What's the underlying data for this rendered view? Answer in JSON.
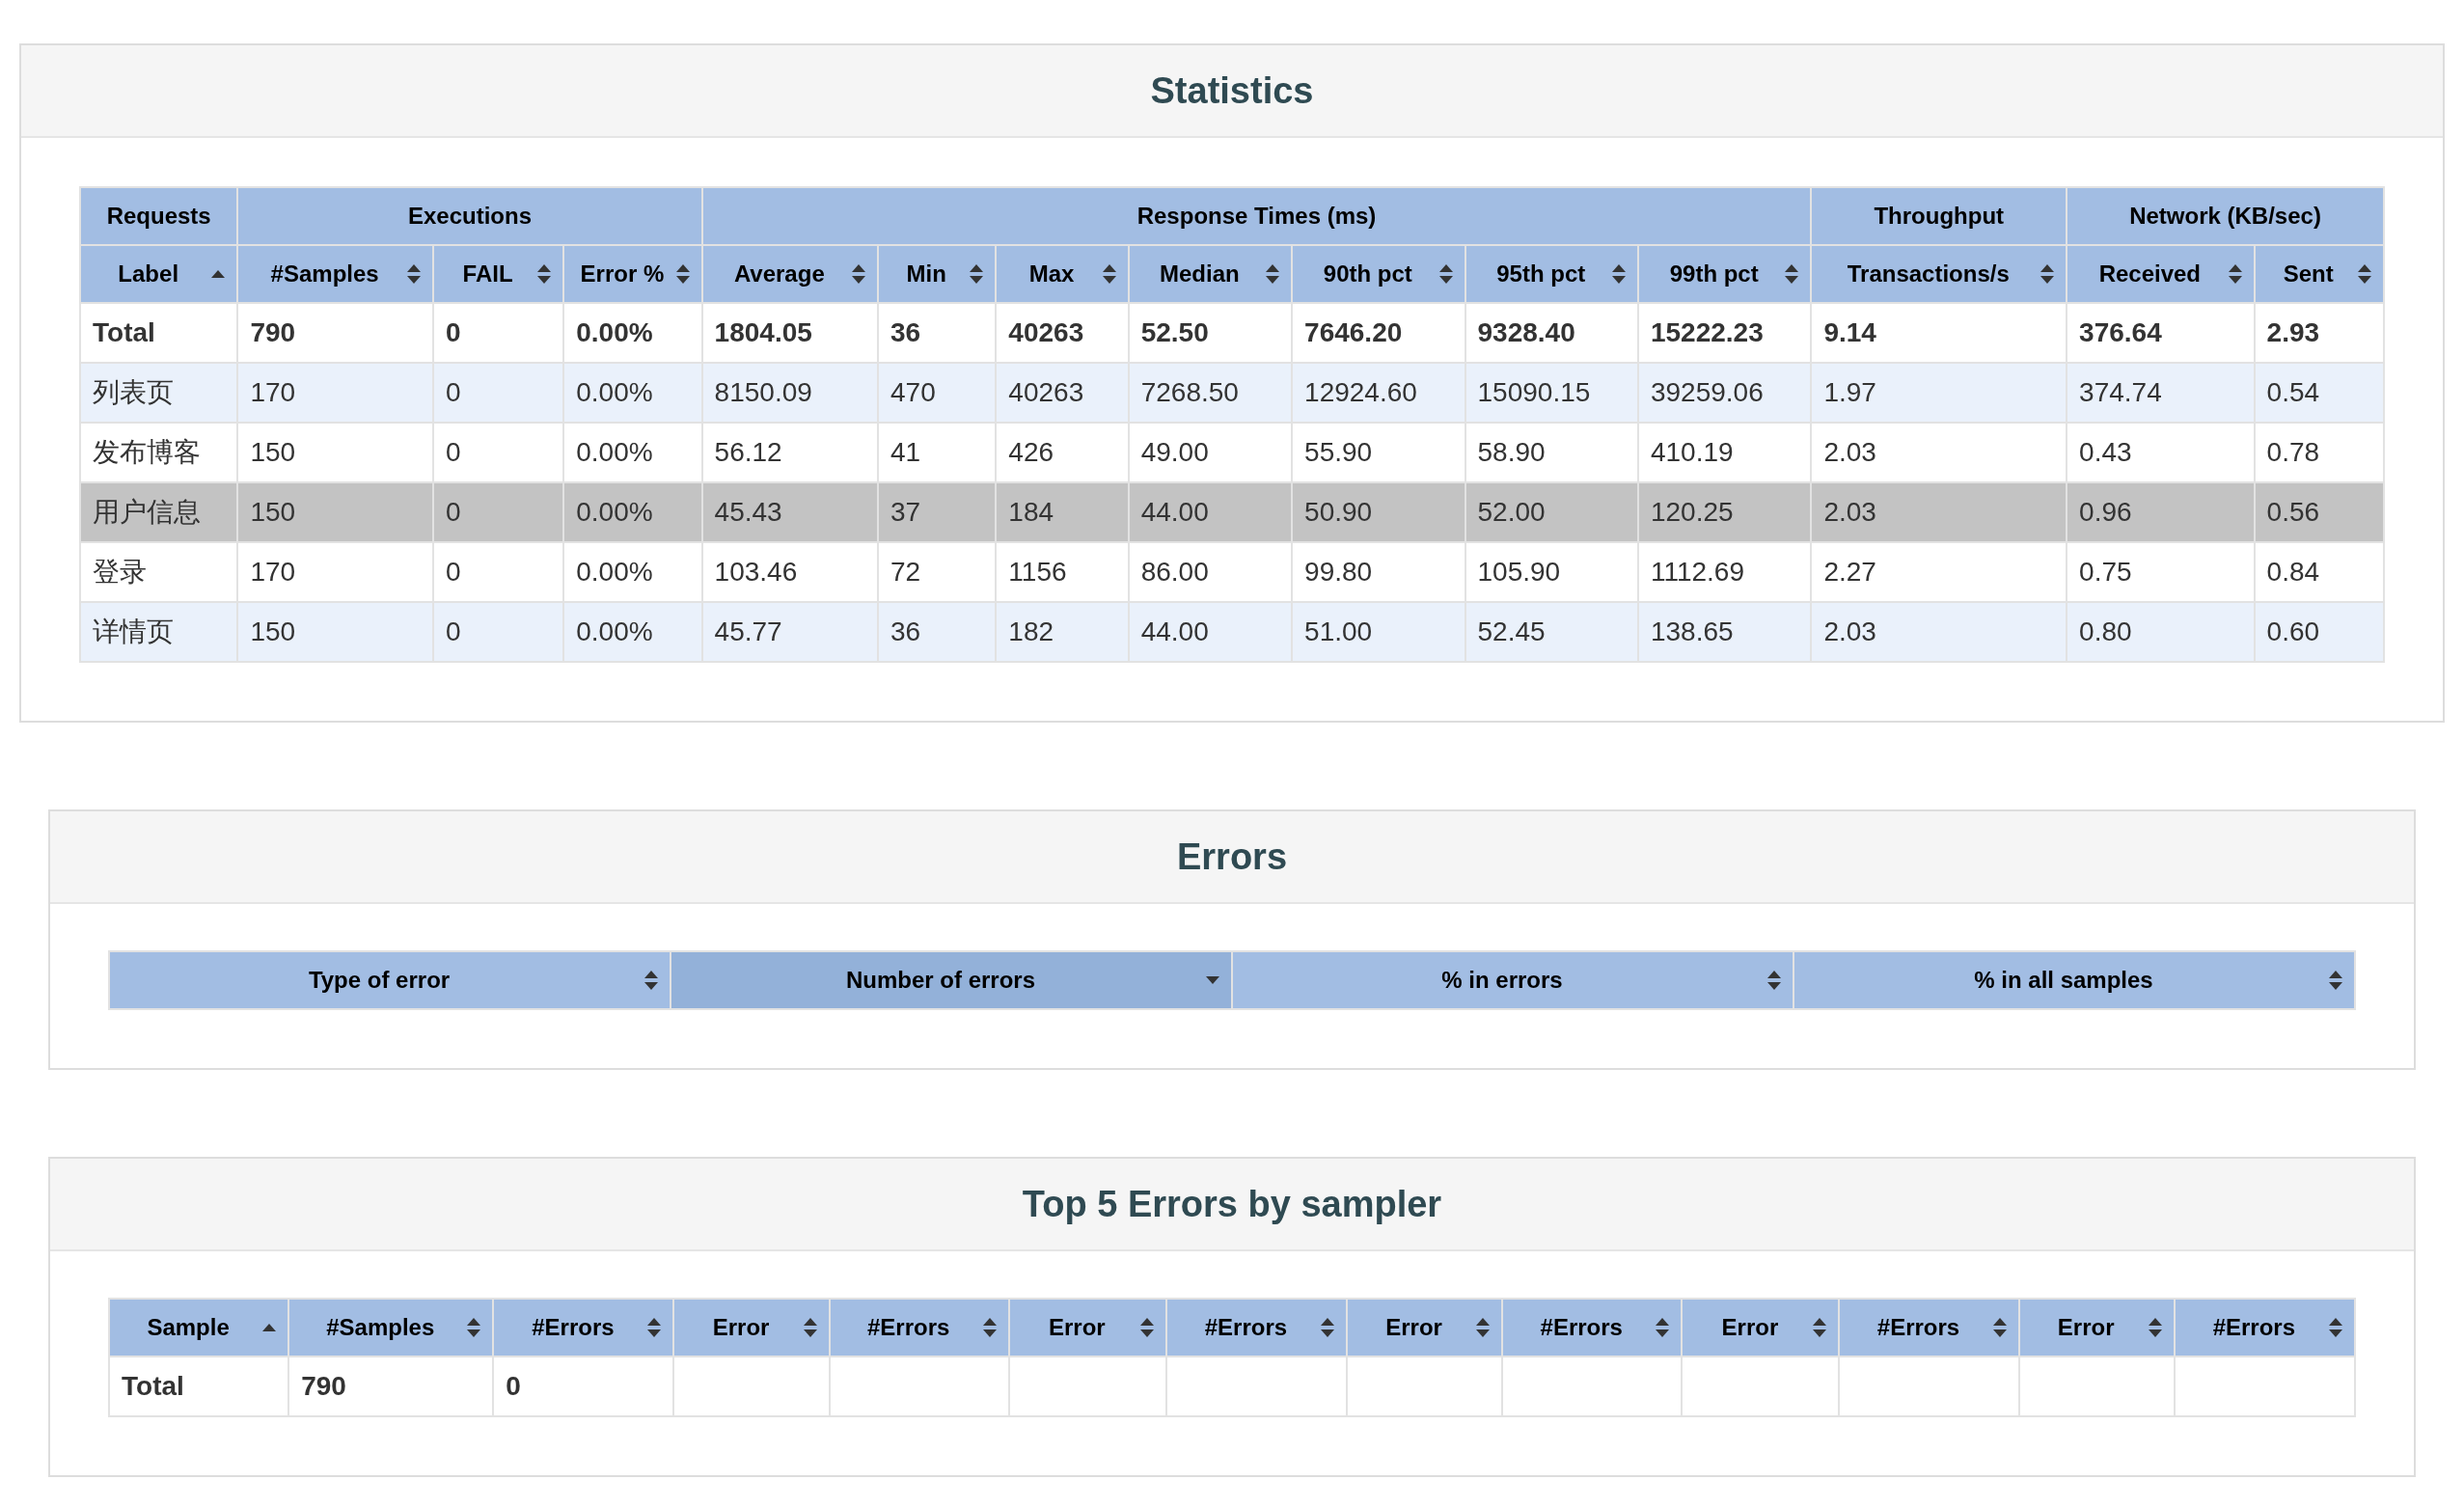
{
  "statistics": {
    "title": "Statistics",
    "groups": [
      {
        "label": "Requests",
        "columns": [
          {
            "label": "Label",
            "sort_asc": true,
            "sort_desc": false
          }
        ]
      },
      {
        "label": "Executions",
        "columns": [
          {
            "label": "#Samples",
            "sort_asc": false,
            "sort_desc": false
          },
          {
            "label": "FAIL",
            "sort_asc": false,
            "sort_desc": false
          },
          {
            "label": "Error %",
            "sort_asc": false,
            "sort_desc": false
          }
        ]
      },
      {
        "label": "Response Times (ms)",
        "columns": [
          {
            "label": "Average",
            "sort_asc": false,
            "sort_desc": false
          },
          {
            "label": "Min",
            "sort_asc": false,
            "sort_desc": false
          },
          {
            "label": "Max",
            "sort_asc": false,
            "sort_desc": false
          },
          {
            "label": "Median",
            "sort_asc": false,
            "sort_desc": false
          },
          {
            "label": "90th pct",
            "sort_asc": false,
            "sort_desc": false
          },
          {
            "label": "95th pct",
            "sort_asc": false,
            "sort_desc": false
          },
          {
            "label": "99th pct",
            "sort_asc": false,
            "sort_desc": false
          }
        ]
      },
      {
        "label": "Throughput",
        "columns": [
          {
            "label": "Transactions/s",
            "sort_asc": false,
            "sort_desc": false
          }
        ]
      },
      {
        "label": "Network (KB/sec)",
        "columns": [
          {
            "label": "Received",
            "sort_asc": false,
            "sort_desc": false
          },
          {
            "label": "Sent",
            "sort_asc": false,
            "sort_desc": false
          }
        ]
      }
    ],
    "rows": [
      {
        "kind": "total",
        "selected": false,
        "cells": [
          "Total",
          "790",
          "0",
          "0.00%",
          "1804.05",
          "36",
          "40263",
          "52.50",
          "7646.20",
          "9328.40",
          "15222.23",
          "9.14",
          "376.64",
          "2.93"
        ]
      },
      {
        "kind": "sample",
        "selected": false,
        "cells": [
          "列表页",
          "170",
          "0",
          "0.00%",
          "8150.09",
          "470",
          "40263",
          "7268.50",
          "12924.60",
          "15090.15",
          "39259.06",
          "1.97",
          "374.74",
          "0.54"
        ]
      },
      {
        "kind": "sample",
        "selected": false,
        "cells": [
          "发布博客",
          "150",
          "0",
          "0.00%",
          "56.12",
          "41",
          "426",
          "49.00",
          "55.90",
          "58.90",
          "410.19",
          "2.03",
          "0.43",
          "0.78"
        ]
      },
      {
        "kind": "sample",
        "selected": true,
        "cells": [
          "用户信息",
          "150",
          "0",
          "0.00%",
          "45.43",
          "37",
          "184",
          "44.00",
          "50.90",
          "52.00",
          "120.25",
          "2.03",
          "0.96",
          "0.56"
        ]
      },
      {
        "kind": "sample",
        "selected": false,
        "cells": [
          "登录",
          "170",
          "0",
          "0.00%",
          "103.46",
          "72",
          "1156",
          "86.00",
          "99.80",
          "105.90",
          "1112.69",
          "2.27",
          "0.75",
          "0.84"
        ]
      },
      {
        "kind": "sample",
        "selected": false,
        "cells": [
          "详情页",
          "150",
          "0",
          "0.00%",
          "45.77",
          "36",
          "182",
          "44.00",
          "51.00",
          "52.45",
          "138.65",
          "2.03",
          "0.80",
          "0.60"
        ]
      }
    ]
  },
  "errors": {
    "title": "Errors",
    "columns": [
      {
        "label": "Type of error",
        "sort_asc": false,
        "sort_desc": false
      },
      {
        "label": "Number of errors",
        "sort_asc": false,
        "sort_desc": true
      },
      {
        "label": "% in errors",
        "sort_asc": false,
        "sort_desc": false
      },
      {
        "label": "% in all samples",
        "sort_asc": false,
        "sort_desc": false
      }
    ]
  },
  "top5": {
    "title": "Top 5 Errors by sampler",
    "columns": [
      {
        "label": "Sample",
        "sort_asc": true,
        "sort_desc": false
      },
      {
        "label": "#Samples",
        "sort_asc": false,
        "sort_desc": false
      },
      {
        "label": "#Errors",
        "sort_asc": false,
        "sort_desc": false
      },
      {
        "label": "Error",
        "sort_asc": false,
        "sort_desc": false
      },
      {
        "label": "#Errors",
        "sort_asc": false,
        "sort_desc": false
      },
      {
        "label": "Error",
        "sort_asc": false,
        "sort_desc": false
      },
      {
        "label": "#Errors",
        "sort_asc": false,
        "sort_desc": false
      },
      {
        "label": "Error",
        "sort_asc": false,
        "sort_desc": false
      },
      {
        "label": "#Errors",
        "sort_asc": false,
        "sort_desc": false
      },
      {
        "label": "Error",
        "sort_asc": false,
        "sort_desc": false
      },
      {
        "label": "#Errors",
        "sort_asc": false,
        "sort_desc": false
      },
      {
        "label": "Error",
        "sort_asc": false,
        "sort_desc": false
      },
      {
        "label": "#Errors",
        "sort_asc": false,
        "sort_desc": false
      }
    ],
    "rows": [
      {
        "kind": "total",
        "selected": false,
        "cells": [
          "Total",
          "790",
          "0"
        ]
      }
    ]
  }
}
